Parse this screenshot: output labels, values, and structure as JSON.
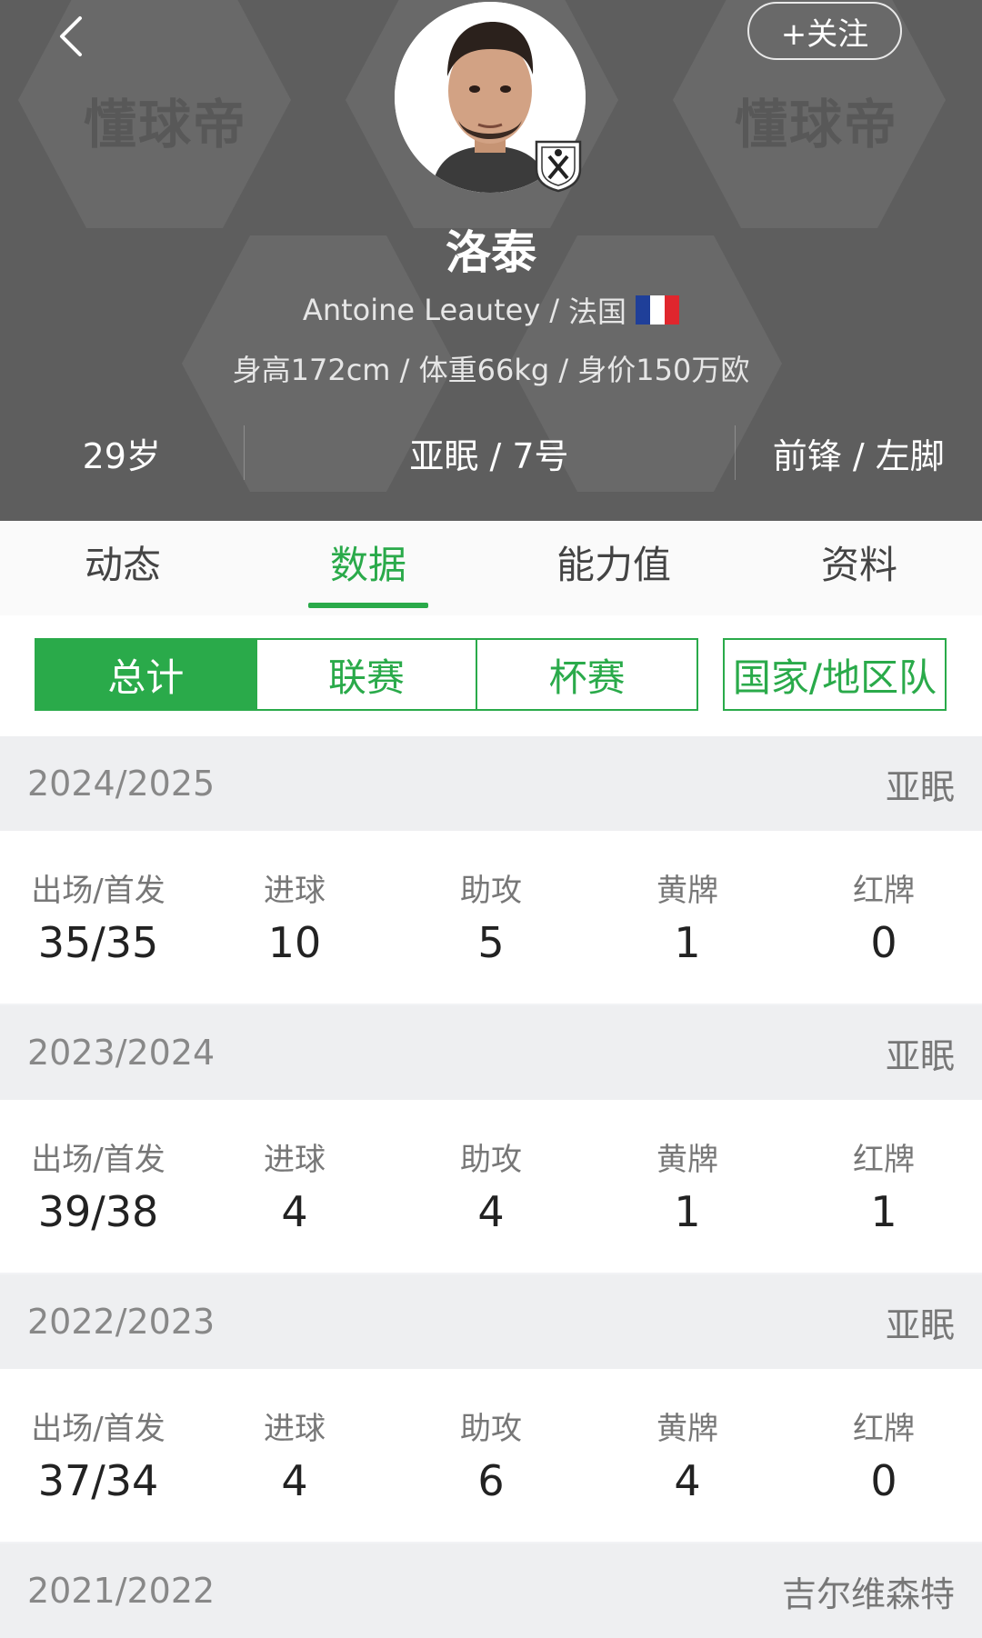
{
  "header": {
    "watermark": "懂球帝",
    "follow_label": "+关注",
    "player_name": "洛泰",
    "english_name": "Antoine Leautey",
    "separator": "/",
    "nationality": "法国",
    "body_info": "身高172cm / 体重66kg / 身价150万欧",
    "age": "29岁",
    "club_number": "亚眠 / 7号",
    "position_foot": "前锋 / 左脚",
    "flag_colors": [
      "#1f3f99",
      "#ffffff",
      "#e0262d"
    ]
  },
  "tabs": [
    {
      "label": "动态",
      "active": false
    },
    {
      "label": "数据",
      "active": true
    },
    {
      "label": "能力值",
      "active": false
    },
    {
      "label": "资料",
      "active": false
    }
  ],
  "filters": {
    "segments": [
      {
        "label": "总计",
        "active": true
      },
      {
        "label": "联赛",
        "active": false
      },
      {
        "label": "杯赛",
        "active": false
      }
    ],
    "national": "国家/地区队"
  },
  "stat_labels": [
    "出场/首发",
    "进球",
    "助攻",
    "黄牌",
    "红牌"
  ],
  "seasons": [
    {
      "season": "2024/2025",
      "team": "亚眠",
      "stats": [
        "35/35",
        "10",
        "5",
        "1",
        "0"
      ]
    },
    {
      "season": "2023/2024",
      "team": "亚眠",
      "stats": [
        "39/38",
        "4",
        "4",
        "1",
        "1"
      ]
    },
    {
      "season": "2022/2023",
      "team": "亚眠",
      "stats": [
        "37/34",
        "4",
        "6",
        "4",
        "0"
      ]
    },
    {
      "season": "2021/2022",
      "team": "吉尔维森特"
    }
  ],
  "colors": {
    "accent": "#2aaa4a",
    "header_bg": "#5e5e5e",
    "section_bg": "#eeeff1"
  }
}
